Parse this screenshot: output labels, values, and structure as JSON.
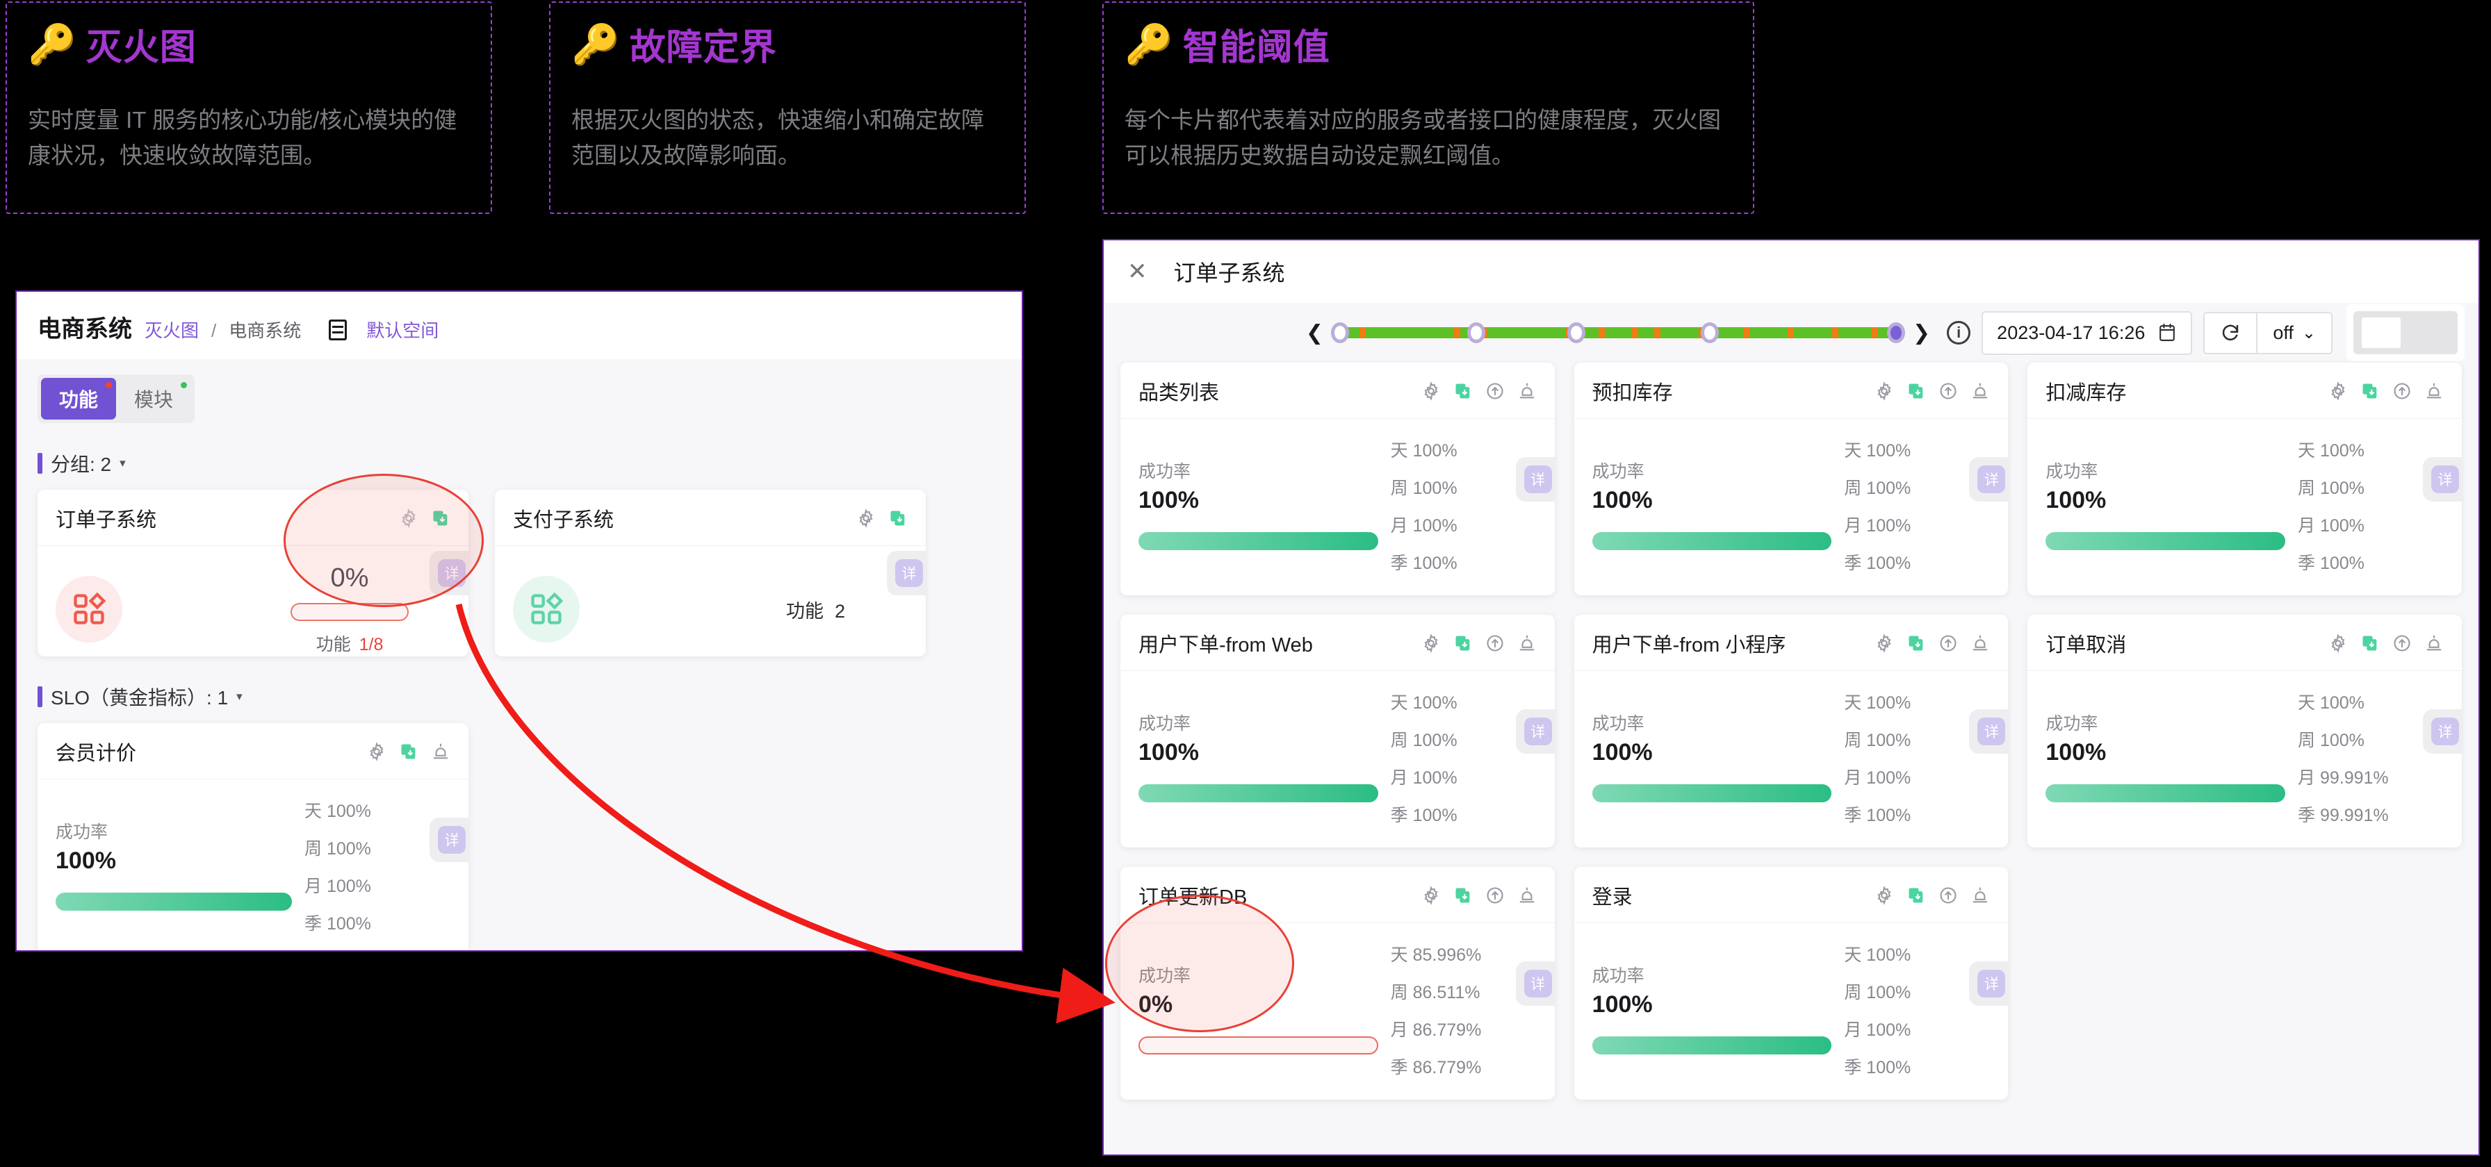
{
  "info_cards": [
    {
      "icon": "key-icon",
      "emoji": "🔑",
      "title": "灭火图",
      "desc": "实时度量 IT 服务的核心功能/核心模块的健康状况，快速收敛故障范围。"
    },
    {
      "icon": "key-icon",
      "emoji": "🔑",
      "title": "故障定界",
      "desc": "根据灭火图的状态，快速缩小和确定故障范围以及故障影响面。"
    },
    {
      "icon": "key-icon",
      "emoji": "🔑",
      "title": "智能阈值",
      "desc": "每个卡片都代表着对应的服务或者接口的健康程度，灭火图可以根据历史数据自动设定飘红阈值。"
    }
  ],
  "left_panel": {
    "title": "电商系统",
    "breadcrumb": {
      "root": "灭火图",
      "sep": "/",
      "current": "电商系统"
    },
    "space_icon": "server-icon",
    "space_name": "默认空间",
    "tabs": [
      {
        "label": "功能",
        "active": true,
        "dot": "red"
      },
      {
        "label": "模块",
        "active": false,
        "dot": "green"
      }
    ],
    "group_section": {
      "label": "分组: 2",
      "caret": "▾"
    },
    "feature_cards": [
      {
        "name": "订单子系统",
        "icon": "grid-icon",
        "tone": "red",
        "percent": "0%",
        "progress_empty": true,
        "footer_label": "功能",
        "footer_value": "1/8",
        "detail_tab": "详"
      },
      {
        "name": "支付子系统",
        "icon": "grid-icon",
        "tone": "green",
        "percent": "",
        "progress_empty": false,
        "footer_label": "功能",
        "footer_value": "2",
        "detail_tab": "详"
      }
    ],
    "slo_section": {
      "label": "SLO（黄金指标）: 1",
      "caret": "▾"
    },
    "slo_cards": [
      {
        "name": "会员计价",
        "rate_label": "成功率",
        "rate_value": "100%",
        "bar_empty": false,
        "detail_tab": "详",
        "metrics": [
          {
            "k": "天",
            "v": "100%"
          },
          {
            "k": "周",
            "v": "100%"
          },
          {
            "k": "月",
            "v": "100%"
          },
          {
            "k": "季",
            "v": "100%"
          }
        ]
      }
    ]
  },
  "right_panel": {
    "close_icon": "close-icon",
    "title": "订单子系统",
    "toolbar": {
      "prev_icon": "chevron-left-icon",
      "next_icon": "chevron-right-icon",
      "info_icon": "info-icon",
      "date_value": "2023-04-17 16:26",
      "calendar_icon": "calendar-icon",
      "refresh_icon": "refresh-icon",
      "refresh_interval": "off",
      "refresh_caret": "⌄",
      "layout_toggle": "layout-toggle"
    },
    "timeline": {
      "segments_orange": [
        3.5,
        20.5,
        25.5,
        40.5,
        46.5,
        52.5,
        56.5,
        64.5,
        72.5,
        80.5,
        88.5,
        95.5
      ],
      "knobs": [
        0,
        24.5,
        42.5,
        66.5,
        100
      ]
    },
    "cards": [
      {
        "name": "品类列表",
        "rate_label": "成功率",
        "rate_value": "100%",
        "bar_empty": false,
        "detail_tab": "详",
        "metrics": [
          {
            "k": "天",
            "v": "100%"
          },
          {
            "k": "周",
            "v": "100%"
          },
          {
            "k": "月",
            "v": "100%"
          },
          {
            "k": "季",
            "v": "100%"
          }
        ]
      },
      {
        "name": "预扣库存",
        "rate_label": "成功率",
        "rate_value": "100%",
        "bar_empty": false,
        "detail_tab": "详",
        "metrics": [
          {
            "k": "天",
            "v": "100%"
          },
          {
            "k": "周",
            "v": "100%"
          },
          {
            "k": "月",
            "v": "100%"
          },
          {
            "k": "季",
            "v": "100%"
          }
        ]
      },
      {
        "name": "扣减库存",
        "rate_label": "成功率",
        "rate_value": "100%",
        "bar_empty": false,
        "detail_tab": "详",
        "metrics": [
          {
            "k": "天",
            "v": "100%"
          },
          {
            "k": "周",
            "v": "100%"
          },
          {
            "k": "月",
            "v": "100%"
          },
          {
            "k": "季",
            "v": "100%"
          }
        ]
      },
      {
        "name": "用户下单-from Web",
        "rate_label": "成功率",
        "rate_value": "100%",
        "bar_empty": false,
        "detail_tab": "详",
        "metrics": [
          {
            "k": "天",
            "v": "100%"
          },
          {
            "k": "周",
            "v": "100%"
          },
          {
            "k": "月",
            "v": "100%"
          },
          {
            "k": "季",
            "v": "100%"
          }
        ]
      },
      {
        "name": "用户下单-from 小程序",
        "rate_label": "成功率",
        "rate_value": "100%",
        "bar_empty": false,
        "detail_tab": "详",
        "metrics": [
          {
            "k": "天",
            "v": "100%"
          },
          {
            "k": "周",
            "v": "100%"
          },
          {
            "k": "月",
            "v": "100%"
          },
          {
            "k": "季",
            "v": "100%"
          }
        ]
      },
      {
        "name": "订单取消",
        "rate_label": "成功率",
        "rate_value": "100%",
        "bar_empty": false,
        "detail_tab": "详",
        "metrics": [
          {
            "k": "天",
            "v": "100%"
          },
          {
            "k": "周",
            "v": "100%"
          },
          {
            "k": "月",
            "v": "99.991%"
          },
          {
            "k": "季",
            "v": "99.991%"
          }
        ]
      },
      {
        "name": "订单更新DB",
        "rate_label": "成功率",
        "rate_value": "0%",
        "bar_empty": true,
        "detail_tab": "详",
        "metrics": [
          {
            "k": "天",
            "v": "85.996%"
          },
          {
            "k": "周",
            "v": "86.511%"
          },
          {
            "k": "月",
            "v": "86.779%"
          },
          {
            "k": "季",
            "v": "86.779%"
          }
        ]
      },
      {
        "name": "登录",
        "rate_label": "成功率",
        "rate_value": "100%",
        "bar_empty": false,
        "detail_tab": "详",
        "metrics": [
          {
            "k": "天",
            "v": "100%"
          },
          {
            "k": "周",
            "v": "100%"
          },
          {
            "k": "月",
            "v": "100%"
          },
          {
            "k": "季",
            "v": "100%"
          }
        ]
      }
    ]
  },
  "colors": {
    "accent_purple": "#7152d3",
    "brand_magenta": "#a436d0",
    "success_green": "#2bbd84",
    "danger_red": "#e8453c",
    "timeline_green": "#5cc126",
    "timeline_orange": "#f07c13"
  }
}
